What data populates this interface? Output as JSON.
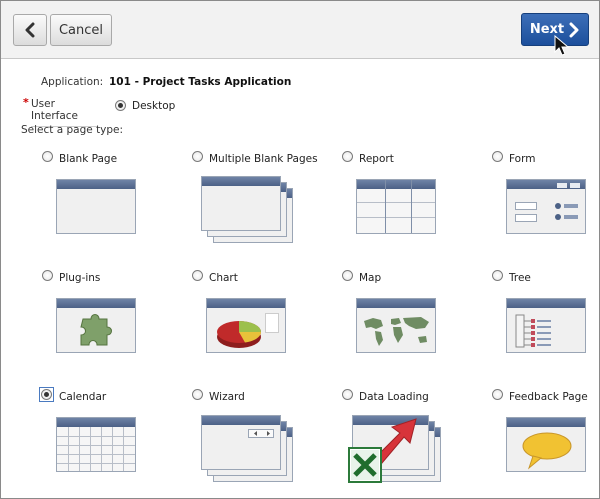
{
  "toolbar": {
    "back_icon": "chevron-left-icon",
    "cancel_label": "Cancel",
    "next_label": "Next",
    "next_icon": "chevron-right-icon"
  },
  "form": {
    "application_label": "Application:",
    "application_value": "101 - Project Tasks Application",
    "ui_required_mark": "*",
    "ui_label": "User Interface",
    "ui_option": "Desktop",
    "ui_selected": true,
    "page_type_label": "Select a page type:"
  },
  "page_types": [
    {
      "label": "Blank Page",
      "icon": "blank-page-thumbnail",
      "selected": false
    },
    {
      "label": "Multiple Blank Pages",
      "icon": "multiple-blank-pages-thumbnail",
      "selected": false
    },
    {
      "label": "Report",
      "icon": "report-thumbnail",
      "selected": false
    },
    {
      "label": "Form",
      "icon": "form-thumbnail",
      "selected": false
    },
    {
      "label": "Plug-ins",
      "icon": "plugins-thumbnail",
      "selected": false
    },
    {
      "label": "Chart",
      "icon": "chart-thumbnail",
      "selected": false
    },
    {
      "label": "Map",
      "icon": "map-thumbnail",
      "selected": false
    },
    {
      "label": "Tree",
      "icon": "tree-thumbnail",
      "selected": false
    },
    {
      "label": "Calendar",
      "icon": "calendar-thumbnail",
      "selected": true
    },
    {
      "label": "Wizard",
      "icon": "wizard-thumbnail",
      "selected": false
    },
    {
      "label": "Data Loading",
      "icon": "data-loading-thumbnail",
      "selected": false
    },
    {
      "label": "Feedback Page",
      "icon": "feedback-page-thumbnail",
      "selected": false
    }
  ],
  "colors": {
    "accent": "#1c4f9c",
    "window_bar": "#566b8f",
    "required": "#cc0000"
  }
}
